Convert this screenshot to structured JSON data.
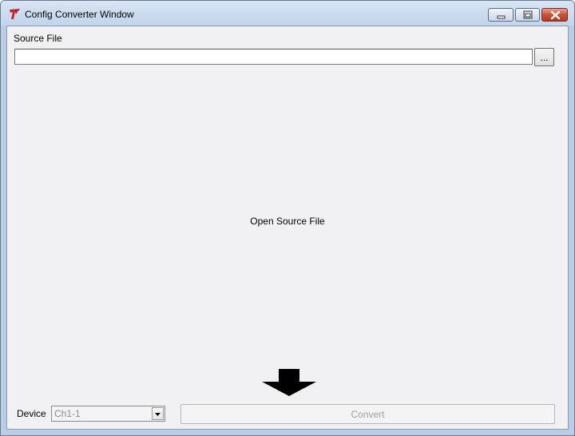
{
  "window": {
    "title": "Config Converter Window",
    "icon": "app-logo-icon",
    "controls": {
      "minimize": "minimize-icon",
      "maximize": "maximize-icon",
      "close": "close-icon"
    }
  },
  "source": {
    "label": "Source File",
    "value": "",
    "browse_label": "..."
  },
  "main": {
    "message": "Open Source File",
    "arrow_icon": "arrow-down-icon"
  },
  "device": {
    "label": "Device",
    "selected": "Ch1-1"
  },
  "convert": {
    "label": "Convert",
    "enabled": false
  },
  "colors": {
    "client_background": "#f1f0f2",
    "close_button": "#c9513a",
    "disabled_text": "#a0a0a0"
  }
}
